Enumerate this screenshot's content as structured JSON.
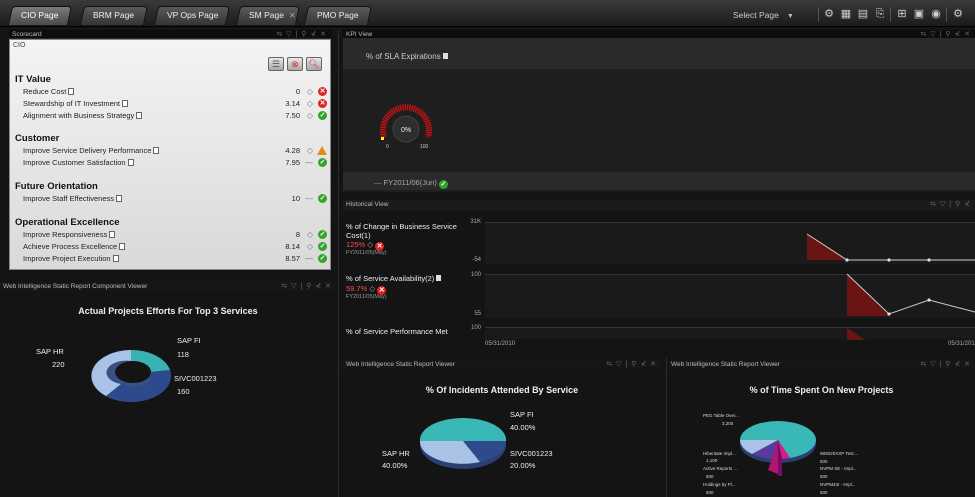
{
  "tabs": [
    {
      "label": "CIO Page",
      "active": true
    },
    {
      "label": "BRM Page",
      "active": false
    },
    {
      "label": "VP Ops Page",
      "active": false
    },
    {
      "label": "SM Page",
      "active": false
    },
    {
      "label": "PMO Page",
      "active": false
    }
  ],
  "toolbar": {
    "select_page": "Select Page",
    "icons": [
      "gear-icon",
      "layout-icon",
      "grid-icon",
      "page-icon",
      "tree-icon",
      "save-icon",
      "target-icon",
      "settings-icon"
    ]
  },
  "scorecard": {
    "header": "Scorecard",
    "owner": "CIO",
    "categories": [
      {
        "title": "IT Value",
        "kpis": [
          {
            "name": "Reduce Cost",
            "value": "0",
            "status": "red"
          },
          {
            "name": "Stewardship of IT Investment",
            "value": "3.14",
            "status": "red"
          },
          {
            "name": "Alignment with Business Strategy",
            "value": "7.50",
            "status": "green"
          }
        ]
      },
      {
        "title": "Customer",
        "kpis": [
          {
            "name": "Improve Service Delivery Performance",
            "value": "4.28",
            "status": "warn"
          },
          {
            "name": "Improve Customer Satisfaction",
            "value": "7.95",
            "status": "green"
          }
        ]
      },
      {
        "title": "Future Orientation",
        "kpis": [
          {
            "name": "Improve Staff Effectiveness",
            "value": "10",
            "status": "green"
          }
        ]
      },
      {
        "title": "Operational Excellence",
        "kpis": [
          {
            "name": "Improve Responsiveness",
            "value": "8",
            "status": "green"
          },
          {
            "name": "Achieve Process Excellence",
            "value": "8.14",
            "status": "green"
          },
          {
            "name": "Improve Project Execution",
            "value": "8.57",
            "status": "green"
          }
        ]
      }
    ]
  },
  "kpi_view": {
    "header": "KPI View",
    "metric": "% of SLA Expirations",
    "gauge_value": "0%",
    "gauge_min": "0",
    "gauge_max": "100",
    "period": "FY2011/06(Jun)"
  },
  "historical": {
    "header": "Historical View",
    "rows": [
      {
        "label": "% of Change in Business Service Cost(1)",
        "value": "125%",
        "date": "FY2011/05(May)",
        "tick_top": "31K",
        "tick_bottom": "-54"
      },
      {
        "label": "% of Service Availability(2)",
        "value": "59.7%",
        "date": "FY2011/05(May)",
        "tick_top": "100",
        "tick_bottom": "55"
      },
      {
        "label": "% of Service Performance Met",
        "value": "",
        "date": "",
        "tick_top": "100",
        "tick_bottom": ""
      }
    ],
    "axis_start": "05/31/2010",
    "axis_end": "05/31/201"
  },
  "report1": {
    "header": "Web Intelligence Static Report Component Viewer",
    "title": "Actual Projects Efforts For Top 3 Services",
    "labels": [
      {
        "name": "SAP HR",
        "value": "220"
      },
      {
        "name": "SAP FI",
        "value": "118"
      },
      {
        "name": "SIVC001223",
        "value": "160"
      }
    ]
  },
  "report2": {
    "header": "Web Intelligence Static Report Viewer",
    "title": "% Of Incidents Attended By Service",
    "labels": [
      {
        "name": "SAP FI",
        "value": "40.00%"
      },
      {
        "name": "SAP HR",
        "value": "40.00%"
      },
      {
        "name": "SIVC001223",
        "value": "20.00%"
      }
    ]
  },
  "report3": {
    "header": "Web Intelligence Static Report Viewer",
    "title": "% of Time Spent On New Projects",
    "labels": [
      {
        "name": "PEG Table Over...",
        "value": "3,200"
      },
      {
        "name": "Hiberitate Impl...",
        "value": "1,100"
      },
      {
        "name": "Active Reports ...",
        "value": "500"
      },
      {
        "name": "Holdings by Pl...",
        "value": "500"
      },
      {
        "name": "WEB20XXP Test ...",
        "value": "500"
      },
      {
        "name": "NVPM SE - Impl...",
        "value": "500"
      },
      {
        "name": "NVPM43I - Impl...",
        "value": "500"
      }
    ]
  }
}
